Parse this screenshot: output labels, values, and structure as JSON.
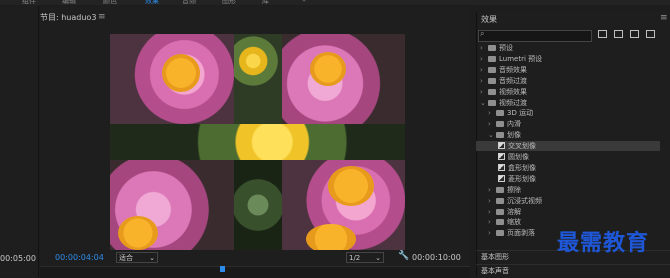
{
  "menubar": {
    "items": [
      "组件",
      "编辑",
      "颜色",
      "效果",
      "音频",
      "图形",
      "库"
    ],
    "active_index": 3
  },
  "left_panel": {
    "timecode": "00:05:00"
  },
  "program_monitor": {
    "title": "节目: huaduo3",
    "menu_icon": "hamburger-icon",
    "current_timecode": "00:00:04:04",
    "fit_option": "适合",
    "resolution_option": "1/2",
    "duration_timecode": "00:00:10:00"
  },
  "effects_panel": {
    "title": "效果",
    "search_placeholder": "",
    "tree": [
      {
        "label": "预设",
        "type": "folder",
        "expanded": false,
        "level": 0
      },
      {
        "label": "Lumetri 预设",
        "type": "folder",
        "expanded": false,
        "level": 0
      },
      {
        "label": "音频效果",
        "type": "folder",
        "expanded": false,
        "level": 0
      },
      {
        "label": "音频过渡",
        "type": "folder",
        "expanded": false,
        "level": 0
      },
      {
        "label": "视频效果",
        "type": "folder",
        "expanded": false,
        "level": 0
      },
      {
        "label": "视频过渡",
        "type": "folder",
        "expanded": true,
        "level": 0
      },
      {
        "label": "3D 运动",
        "type": "folder",
        "expanded": false,
        "level": 1
      },
      {
        "label": "内滑",
        "type": "folder",
        "expanded": false,
        "level": 1
      },
      {
        "label": "划像",
        "type": "folder",
        "expanded": true,
        "level": 1
      },
      {
        "label": "交叉划像",
        "type": "effect",
        "level": 2,
        "selected": true
      },
      {
        "label": "圆划像",
        "type": "effect",
        "level": 2
      },
      {
        "label": "盒形划像",
        "type": "effect",
        "level": 2
      },
      {
        "label": "菱形划像",
        "type": "effect",
        "level": 2
      },
      {
        "label": "擦除",
        "type": "folder",
        "expanded": false,
        "level": 1
      },
      {
        "label": "沉浸式视频",
        "type": "folder",
        "expanded": false,
        "level": 1
      },
      {
        "label": "溶解",
        "type": "folder",
        "expanded": false,
        "level": 1
      },
      {
        "label": "缩放",
        "type": "folder",
        "expanded": false,
        "level": 1
      },
      {
        "label": "页面剥落",
        "type": "folder",
        "expanded": false,
        "level": 1
      }
    ],
    "sections": [
      "基本图形",
      "基本声音"
    ]
  },
  "watermark": {
    "text": "最需教育"
  },
  "colors": {
    "accent": "#2d8ceb",
    "watermark": "#1e57d8",
    "background": "#1d1d1d"
  }
}
